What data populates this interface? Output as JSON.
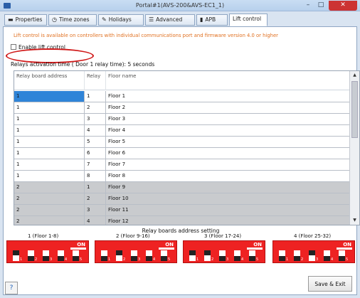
{
  "window": {
    "title": "Portal#1(AVS-200&AVS-EC1_1)",
    "minimize": "–",
    "maximize": "□",
    "close": "✕"
  },
  "tabs": [
    {
      "label": "Properties",
      "icon": "minus-icon",
      "glyph": "▬"
    },
    {
      "label": "Time zones",
      "icon": "clock-icon",
      "glyph": "◷"
    },
    {
      "label": "Holidays",
      "icon": "calendar-icon",
      "glyph": "✎"
    },
    {
      "label": "Advanced",
      "icon": "advanced-icon",
      "glyph": "☰"
    },
    {
      "label": "APB",
      "icon": "apb-icon",
      "glyph": "▮"
    },
    {
      "label": "Lift control",
      "icon": "",
      "glyph": ""
    }
  ],
  "note": "Lift control is available on controllers with individual communications port and firmware version 4.0 or higher",
  "enable_label": "Enable lift control",
  "relay_label": "Relays activation time ( Door 1 relay time): 5 seconds",
  "grid": {
    "headers": [
      "Relay board address",
      "Relay",
      "Floor name"
    ],
    "rows": [
      {
        "addr": "1",
        "relay": "1",
        "floor": "Floor 1",
        "shade": false
      },
      {
        "addr": "1",
        "relay": "2",
        "floor": "Floor 2",
        "shade": false
      },
      {
        "addr": "1",
        "relay": "3",
        "floor": "Floor 3",
        "shade": false
      },
      {
        "addr": "1",
        "relay": "4",
        "floor": "Floor 4",
        "shade": false
      },
      {
        "addr": "1",
        "relay": "5",
        "floor": "Floor 5",
        "shade": false
      },
      {
        "addr": "1",
        "relay": "6",
        "floor": "Floor 6",
        "shade": false
      },
      {
        "addr": "1",
        "relay": "7",
        "floor": "Floor 7",
        "shade": false
      },
      {
        "addr": "1",
        "relay": "8",
        "floor": "Floor 8",
        "shade": false
      },
      {
        "addr": "2",
        "relay": "1",
        "floor": "Floor 9",
        "shade": true
      },
      {
        "addr": "2",
        "relay": "2",
        "floor": "Floor 10",
        "shade": true
      },
      {
        "addr": "2",
        "relay": "3",
        "floor": "Floor 11",
        "shade": true
      },
      {
        "addr": "2",
        "relay": "4",
        "floor": "Floor 12",
        "shade": true
      }
    ]
  },
  "dip_caption": "Relay boards address setting",
  "dip_switches": [
    {
      "label": "1 (Floor 1-8)",
      "on_text": "ON",
      "states": [
        1,
        0,
        0,
        0,
        0
      ]
    },
    {
      "label": "2 (Floor 9-16)",
      "on_text": "ON",
      "states": [
        0,
        1,
        0,
        0,
        0
      ]
    },
    {
      "label": "3 (Floor 17-24)",
      "on_text": "ON",
      "states": [
        1,
        1,
        0,
        0,
        0
      ]
    },
    {
      "label": "4 (Floor 25-32)",
      "on_text": "ON",
      "states": [
        0,
        0,
        1,
        0,
        0
      ]
    }
  ],
  "help": "?",
  "save_button": "Save & Exit"
}
